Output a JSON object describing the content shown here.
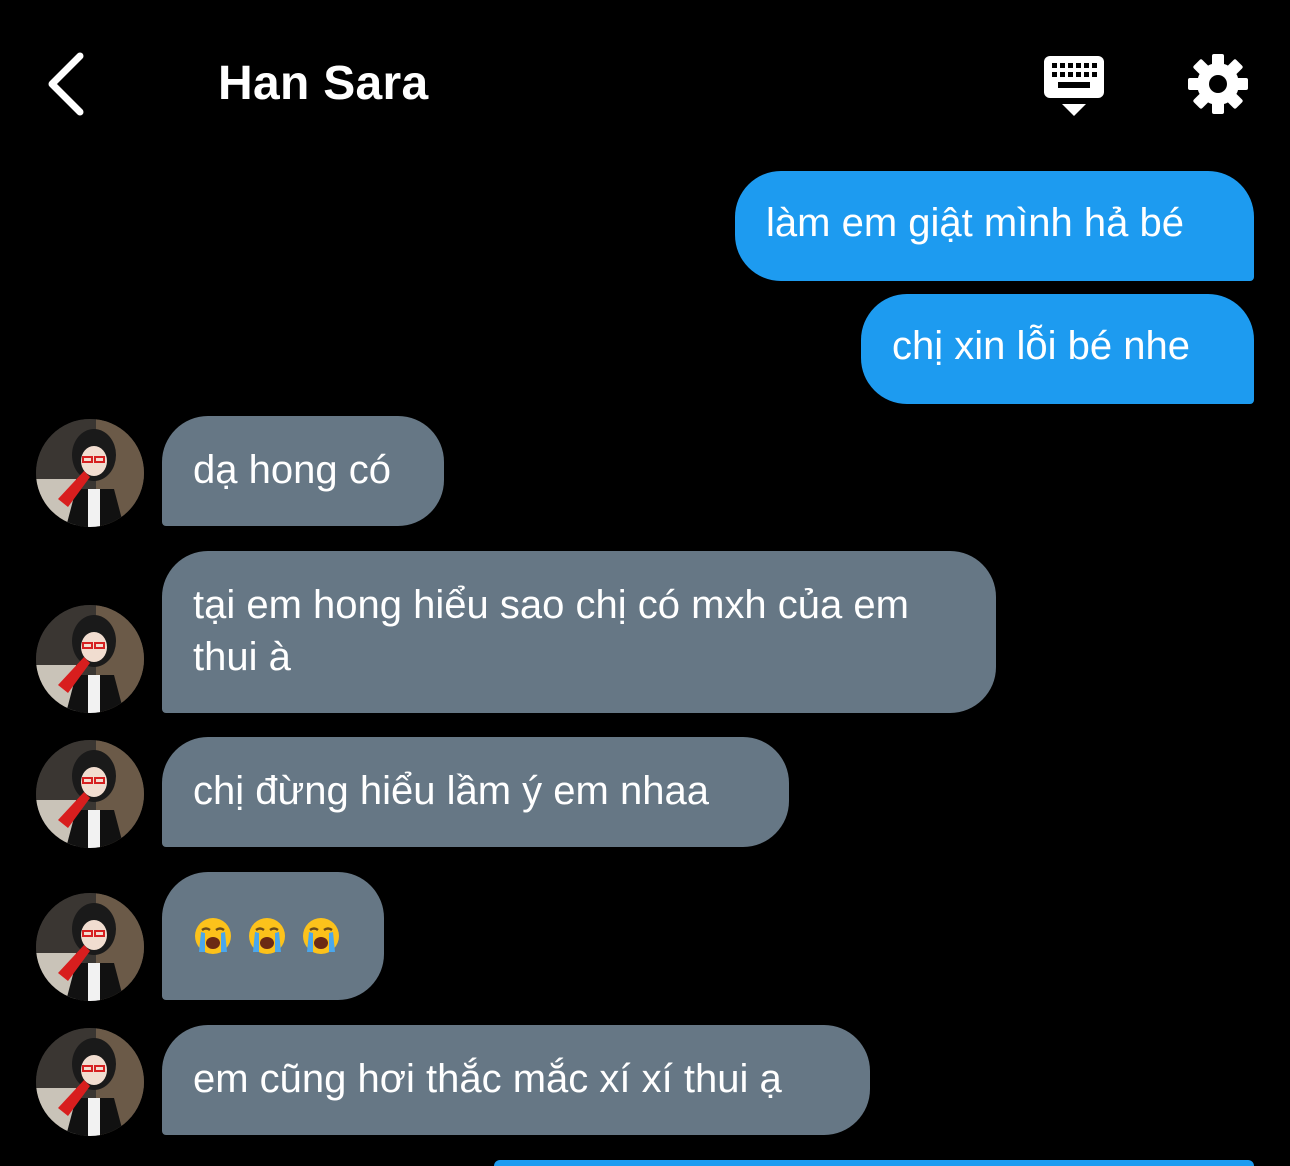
{
  "header": {
    "title": "Han Sara",
    "back_icon": "chevron-left-icon",
    "keyboard_icon": "keyboard-icon",
    "settings_icon": "gear-icon"
  },
  "colors": {
    "background": "#000000",
    "outgoing_bubble": "#1d9bf0",
    "incoming_bubble": "#667785"
  },
  "messages": [
    {
      "direction": "outgoing",
      "text": "làm em giật mình hả bé"
    },
    {
      "direction": "outgoing",
      "text": "chị xin lỗi bé nhe"
    },
    {
      "direction": "incoming",
      "text": "dạ hong có"
    },
    {
      "direction": "incoming",
      "text": "tại em hong hiểu sao chị có mxh của em thui à"
    },
    {
      "direction": "incoming",
      "text": "chị đừng hiểu lầm ý em nhaa"
    },
    {
      "direction": "incoming",
      "text": "",
      "emoji": [
        "loudly-crying-face",
        "loudly-crying-face",
        "loudly-crying-face"
      ]
    },
    {
      "direction": "incoming",
      "text": "em cũng hơi thắc mắc xí xí thui ạ"
    }
  ]
}
